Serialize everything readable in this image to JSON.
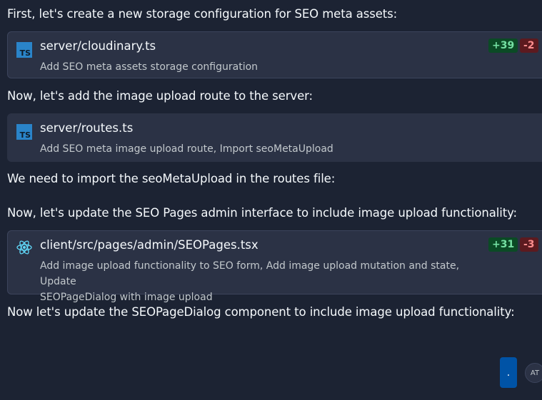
{
  "messages": [
    "First, let's create a new storage configuration for SEO meta assets:",
    "Now, let's add the image upload route to the server:",
    "We need to import the seoMetaUpload in the routes file:",
    "Now, let's update the SEO Pages admin interface to include image upload functionality:",
    "Now let's update the SEOPageDialog component to include image upload functionality:"
  ],
  "files": [
    {
      "icon": "typescript-icon",
      "icon_text": "TS",
      "name": "server/cloudinary.ts",
      "description": "Add SEO meta assets storage configuration",
      "additions": "+39",
      "deletions": "-2"
    },
    {
      "icon": "typescript-icon",
      "icon_text": "TS",
      "name": "server/routes.ts",
      "description": "Add SEO meta image upload route, Import seoMetaUpload"
    },
    {
      "icon": "react-icon",
      "name": "client/src/pages/admin/SEOPages.tsx",
      "description_lines": [
        "Add image upload functionality to SEO form, Add image upload mutation and state, Update",
        "SEOPageDialog with image upload"
      ],
      "additions": "+31",
      "deletions": "-3"
    }
  ],
  "send_button": ".",
  "avatar": "AT",
  "colors": {
    "background": "#1c2333",
    "card": "#2b3245",
    "addition": "#75e0a3",
    "deletion": "#ff8e8e",
    "accent": "#0053a6"
  }
}
